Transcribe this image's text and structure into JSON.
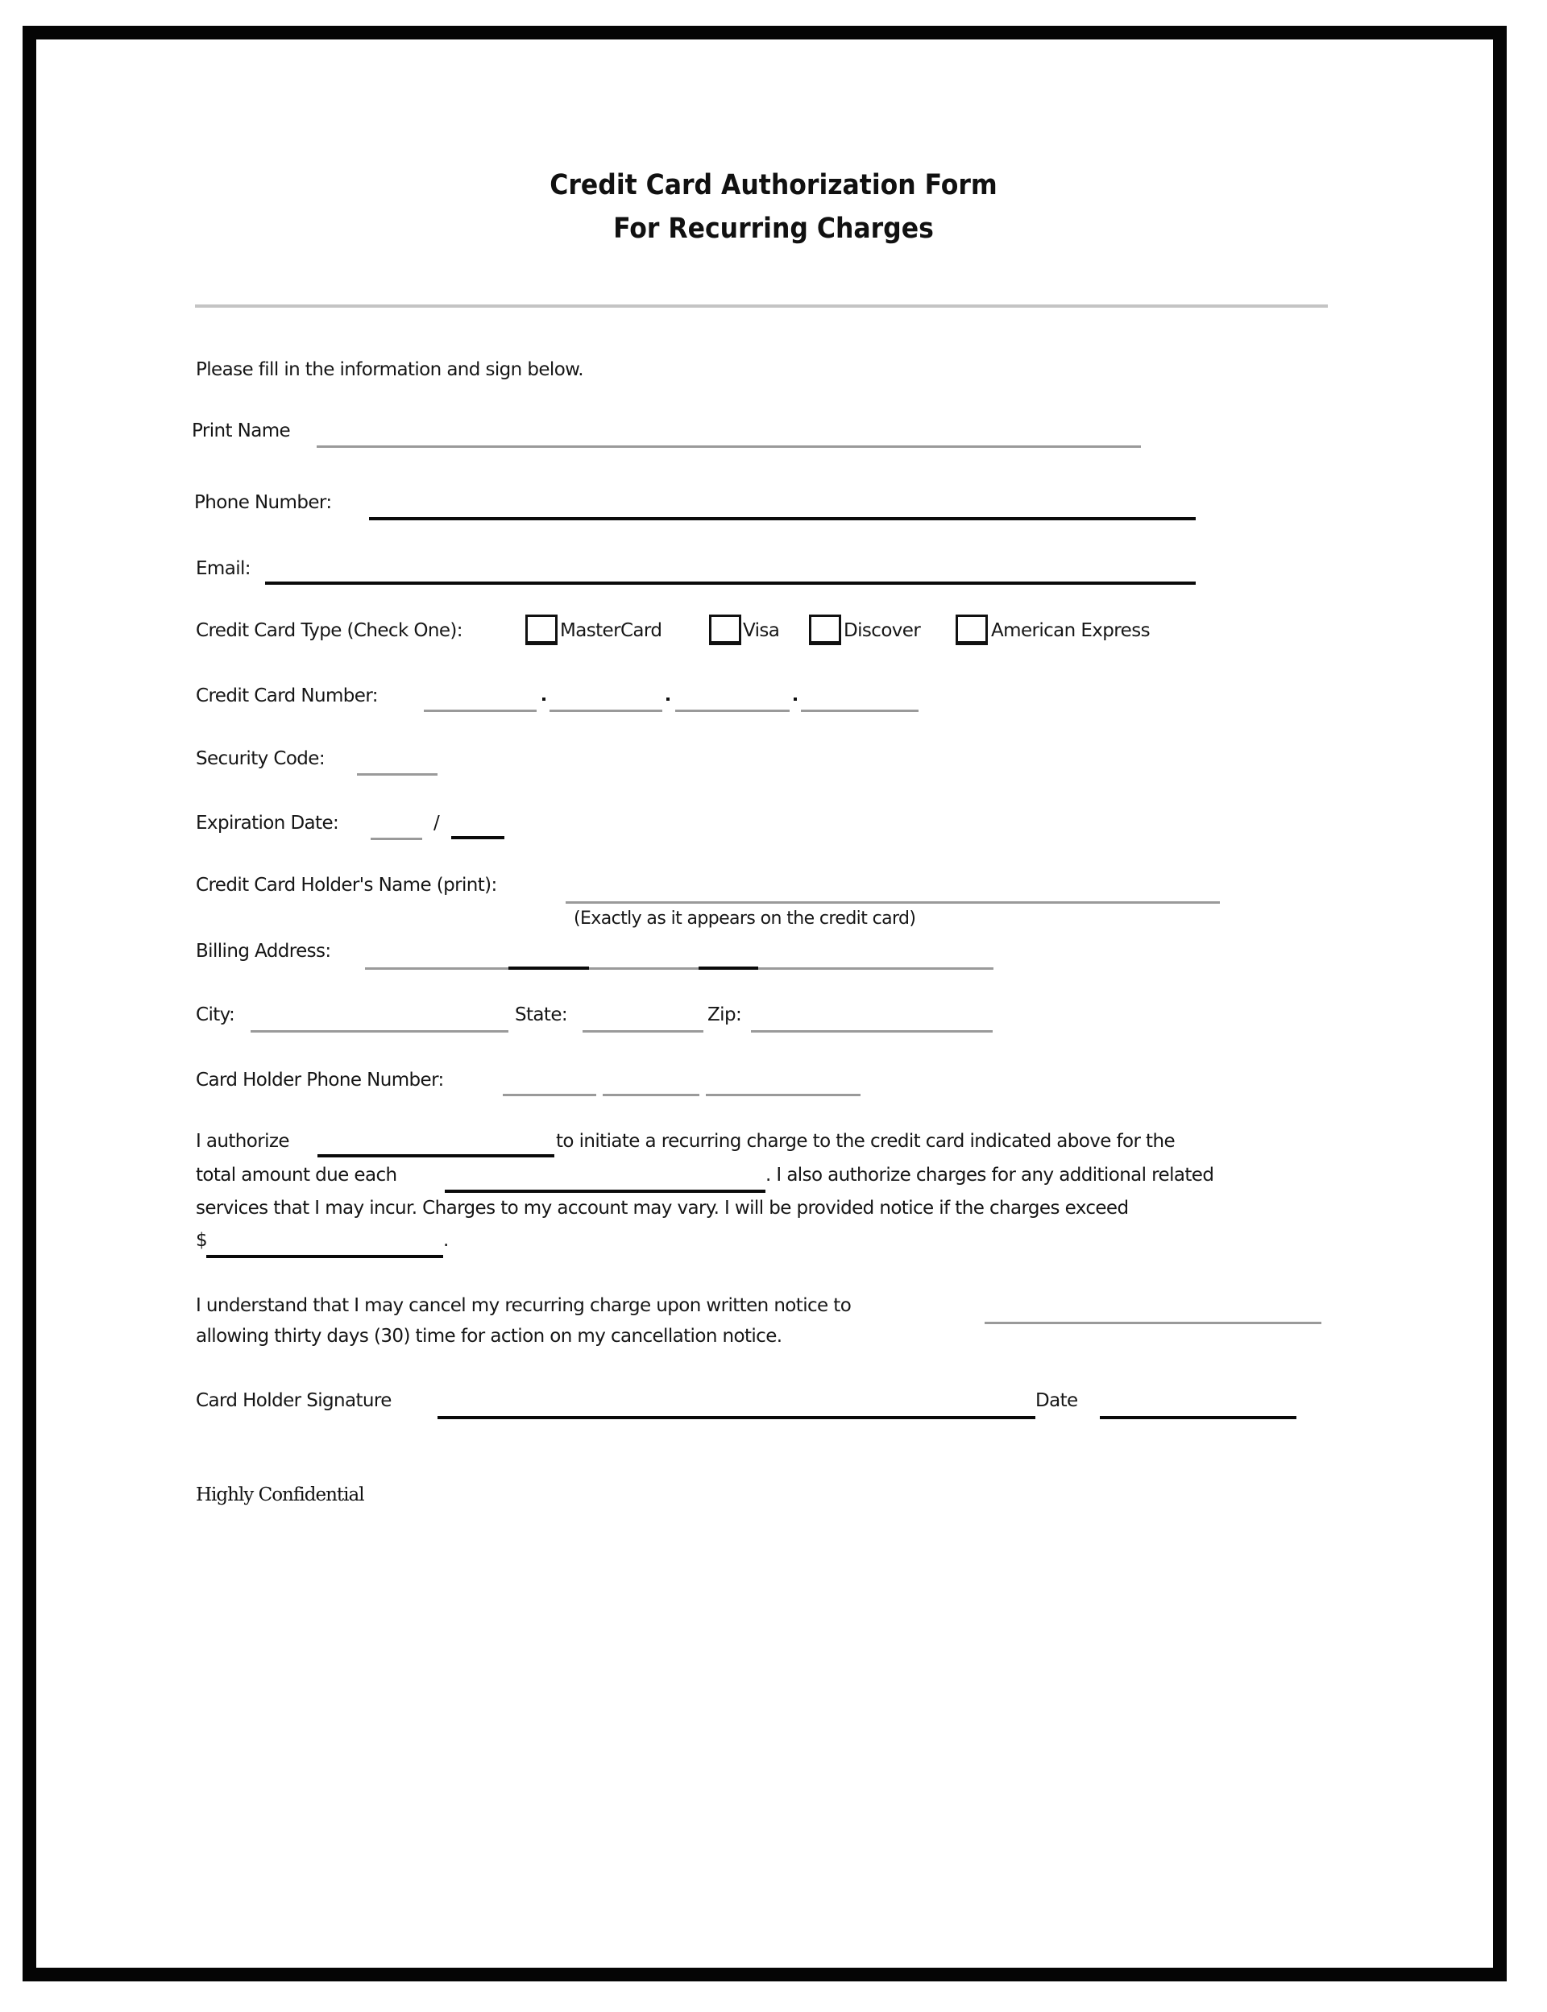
{
  "form": {
    "title_line1": "Credit Card Authorization Form",
    "title_line2": "For Recurring Charges",
    "instruction": "Please fill in the information and sign below.",
    "fields": {
      "print_name": {
        "label": "Print Name",
        "value": ""
      },
      "phone_number": {
        "label": "Phone Number:",
        "value": ""
      },
      "email": {
        "label": "Email:",
        "value": ""
      },
      "card_type": {
        "label": "Credit Card Type (Check One):",
        "options": [
          {
            "label": "MasterCard",
            "checked": false
          },
          {
            "label": "Visa",
            "checked": false
          },
          {
            "label": "Discover",
            "checked": false
          },
          {
            "label": "American Express",
            "checked": false
          }
        ]
      },
      "card_number": {
        "label": "Credit Card Number:",
        "separator": "-",
        "value": ""
      },
      "security_code": {
        "label": "Security Code:",
        "value": ""
      },
      "expiration_date": {
        "label": "Expiration Date:",
        "separator": "/",
        "value": ""
      },
      "holder_name": {
        "label": "Credit Card Holder's Name (print):",
        "note": "(Exactly as it appears on the credit card)",
        "value": ""
      },
      "billing_address": {
        "label": "Billing Address:",
        "value": ""
      },
      "city": {
        "label": "City:",
        "value": ""
      },
      "state": {
        "label": "State:",
        "value": ""
      },
      "zip": {
        "label": "Zip:",
        "value": ""
      },
      "holder_phone": {
        "label": "Card Holder Phone Number:",
        "value": ""
      }
    },
    "authorization": {
      "p1_a": "I authorize",
      "p1_b": "to initiate a recurring charge to the credit card indicated above for the",
      "p2_a": "total amount due each",
      "p2_b": ".  I also authorize charges for any additional related",
      "p3": "services that I may incur.  Charges to my account may vary.  I will be provided notice if the charges exceed",
      "p4_a": "$",
      "p4_b": "."
    },
    "cancellation": {
      "line1": "I understand that I may cancel my recurring charge upon written notice to",
      "line2": "allowing thirty days (30) time for action on my cancellation notice."
    },
    "signature": {
      "label": "Card Holder Signature",
      "date_label": "Date"
    },
    "footer": "Highly Confidential"
  }
}
